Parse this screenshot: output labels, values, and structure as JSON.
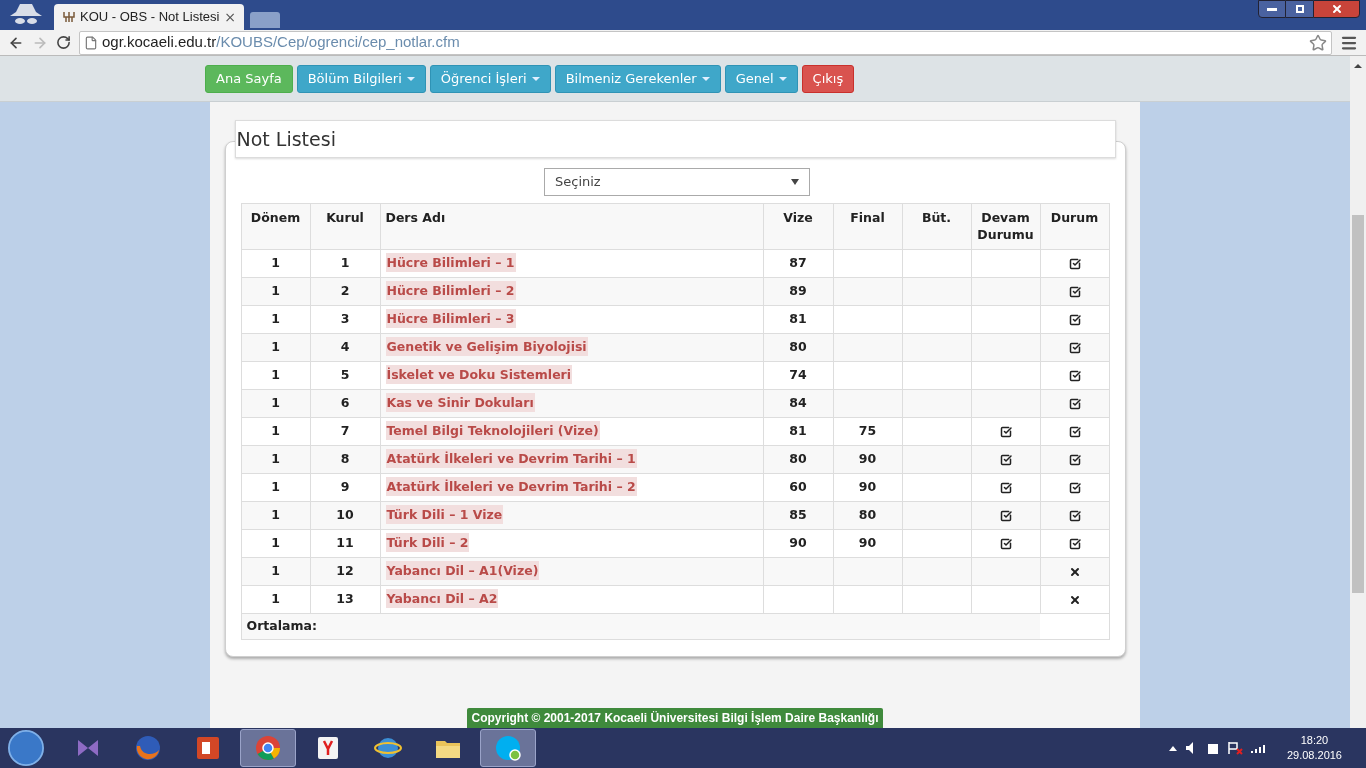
{
  "browser": {
    "tab_title": "KOU - OBS - Not Listesi",
    "tab_close": "×",
    "url_host": "ogr.kocaeli.edu.tr",
    "url_path": "/KOUBS/Cep/ogrenci/cep_notlar.cfm"
  },
  "nav": [
    {
      "label": "Ana Sayfa",
      "kind": "success",
      "dropdown": false
    },
    {
      "label": "Bölüm Bilgileri",
      "kind": "info",
      "dropdown": true
    },
    {
      "label": "Öğrenci İşleri",
      "kind": "info",
      "dropdown": true
    },
    {
      "label": "Bilmeniz Gerekenler",
      "kind": "info",
      "dropdown": true
    },
    {
      "label": "Genel",
      "kind": "info",
      "dropdown": true
    },
    {
      "label": "Çıkış",
      "kind": "danger",
      "dropdown": false
    }
  ],
  "panel_title": "Not Listesi",
  "select": {
    "value": "Seçiniz"
  },
  "table": {
    "columns": [
      "Dönem",
      "Kurul",
      "Ders Adı",
      "Vize",
      "Final",
      "Büt.",
      "Devam Durumu",
      "Durum"
    ],
    "rows": [
      {
        "donem": "1",
        "kurul": "1",
        "ders": "Hücre Bilimleri – 1",
        "vize": "87",
        "final": "",
        "but": "",
        "devam": false,
        "passed": true
      },
      {
        "donem": "1",
        "kurul": "2",
        "ders": "Hücre Bilimleri – 2",
        "vize": "89",
        "final": "",
        "but": "",
        "devam": false,
        "passed": true
      },
      {
        "donem": "1",
        "kurul": "3",
        "ders": "Hücre Bilimleri – 3",
        "vize": "81",
        "final": "",
        "but": "",
        "devam": false,
        "passed": true
      },
      {
        "donem": "1",
        "kurul": "4",
        "ders": "Genetik ve Gelişim Biyolojisi",
        "vize": "80",
        "final": "",
        "but": "",
        "devam": false,
        "passed": true
      },
      {
        "donem": "1",
        "kurul": "5",
        "ders": "İskelet ve Doku Sistemleri",
        "vize": "74",
        "final": "",
        "but": "",
        "devam": false,
        "passed": true
      },
      {
        "donem": "1",
        "kurul": "6",
        "ders": "Kas ve Sinir Dokuları",
        "vize": "84",
        "final": "",
        "but": "",
        "devam": false,
        "passed": true
      },
      {
        "donem": "1",
        "kurul": "7",
        "ders": "Temel Bilgi Teknolojileri (Vize)",
        "vize": "81",
        "final": "75",
        "but": "",
        "devam": true,
        "passed": true
      },
      {
        "donem": "1",
        "kurul": "8",
        "ders": "Atatürk İlkeleri ve Devrim Tarihi – 1",
        "vize": "80",
        "final": "90",
        "but": "",
        "devam": true,
        "passed": true
      },
      {
        "donem": "1",
        "kurul": "9",
        "ders": "Atatürk İlkeleri ve Devrim Tarihi – 2",
        "vize": "60",
        "final": "90",
        "but": "",
        "devam": true,
        "passed": true
      },
      {
        "donem": "1",
        "kurul": "10",
        "ders": "Türk Dili – 1 Vize",
        "vize": "85",
        "final": "80",
        "but": "",
        "devam": true,
        "passed": true
      },
      {
        "donem": "1",
        "kurul": "11",
        "ders": "Türk Dili – 2",
        "vize": "90",
        "final": "90",
        "but": "",
        "devam": true,
        "passed": true
      },
      {
        "donem": "1",
        "kurul": "12",
        "ders": "Yabancı Dil – A1(Vize)",
        "vize": "",
        "final": "",
        "but": "",
        "devam": false,
        "passed": false
      },
      {
        "donem": "1",
        "kurul": "13",
        "ders": "Yabancı Dil – A2",
        "vize": "",
        "final": "",
        "but": "",
        "devam": false,
        "passed": false
      }
    ],
    "average_label": "Ortalama:"
  },
  "footer": "Copyright © 2001-2017 Kocaeli Üniversitesi Bilgi İşlem Daire Başkanlığı",
  "taskbar": {
    "apps": [
      {
        "kind": "vs",
        "active": false
      },
      {
        "kind": "firefox",
        "active": false
      },
      {
        "kind": "powerpoint",
        "active": false
      },
      {
        "kind": "chrome",
        "active": true
      },
      {
        "kind": "yandex",
        "active": false
      },
      {
        "kind": "ie",
        "active": false
      },
      {
        "kind": "folder",
        "active": false
      },
      {
        "kind": "skype",
        "active": true
      }
    ],
    "time": "18:20",
    "date": "29.08.2016"
  }
}
